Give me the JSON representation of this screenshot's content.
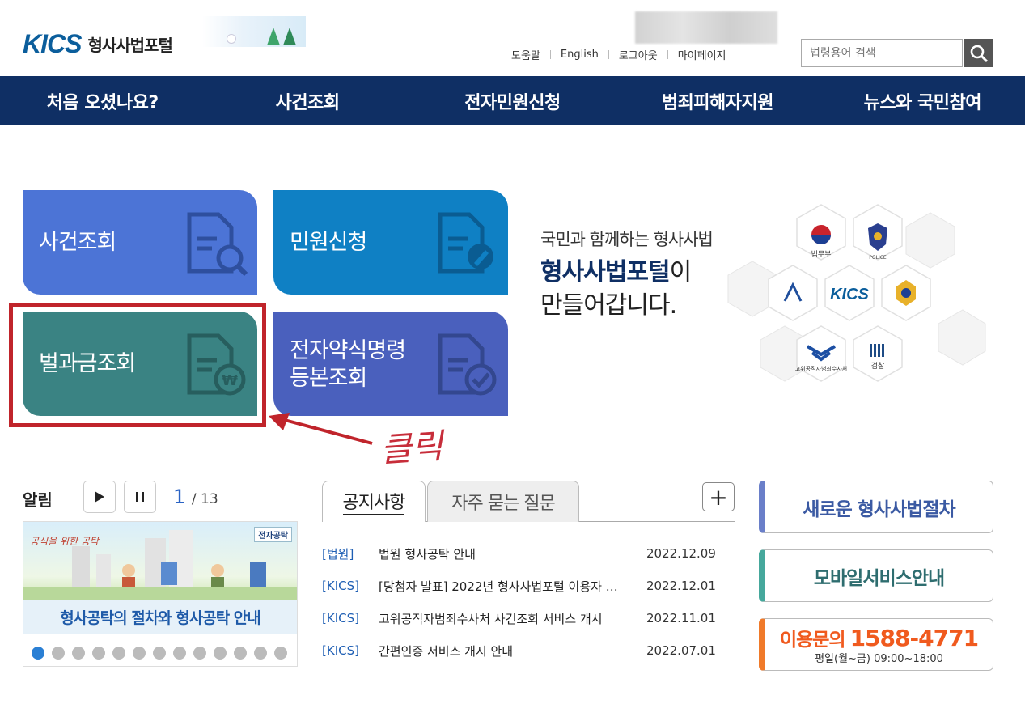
{
  "header": {
    "logo_mark": "KICS",
    "logo_title": "형사사법포털",
    "links": [
      "도움말",
      "English",
      "로그아웃",
      "마이페이지"
    ],
    "search_placeholder": "법령용어 검색"
  },
  "nav": [
    "처음 오셨나요?",
    "사건조회",
    "전자민원신청",
    "범죄피해자지원",
    "뉴스와 국민참여"
  ],
  "tiles": [
    {
      "label": "사건조회",
      "color": "#4c74d6"
    },
    {
      "label": "민원신청",
      "color": "#0f80c4"
    },
    {
      "label": "벌과금조회",
      "color": "#3a8383"
    },
    {
      "label_line1": "전자약식명령",
      "label_line2": "등본조회",
      "color": "#4a60bd"
    }
  ],
  "annotation": {
    "click_text": "클릭",
    "color": "#c0242b"
  },
  "slogan": {
    "line1": "국민과 함께하는 형사사법",
    "line2_bold": "형사사법포털",
    "line2_rest": "이",
    "line3": "만들어갑니다."
  },
  "agencies": {
    "moj": "법무부",
    "police": "POLICE",
    "center": "KICS",
    "cio": "고위공직자범죄수사처",
    "prosecution": "검찰"
  },
  "alarm": {
    "title": "알림",
    "page_current": "1",
    "page_total": "/ 13",
    "banner_caption": "형사공탁의 절차와 형사공탁 안내",
    "banner_badge": "전자공탁",
    "dot_count": 13
  },
  "notices": {
    "tab_active": "공지사항",
    "tab_inactive": "자주 묻는 질문",
    "items": [
      {
        "cat": "[법원]",
        "title": "법원 형사공탁 안내",
        "date": "2022.12.09"
      },
      {
        "cat": "[KICS]",
        "title": "[당첨자 발표] 2022년 형사사법포털 이용자 …",
        "date": "2022.12.01"
      },
      {
        "cat": "[KICS]",
        "title": "고위공직자범죄수사처 사건조회 서비스 개시",
        "date": "2022.11.01"
      },
      {
        "cat": "[KICS]",
        "title": "간편인증 서비스 개시 안내",
        "date": "2022.07.01"
      }
    ]
  },
  "side_buttons": {
    "new_procedure": "새로운 형사사법절차",
    "mobile": "모바일서비스안내",
    "inquiry_label": "이용문의",
    "inquiry_number": "1588-4771",
    "inquiry_hours": "평일(월~금) 09:00~18:00"
  }
}
